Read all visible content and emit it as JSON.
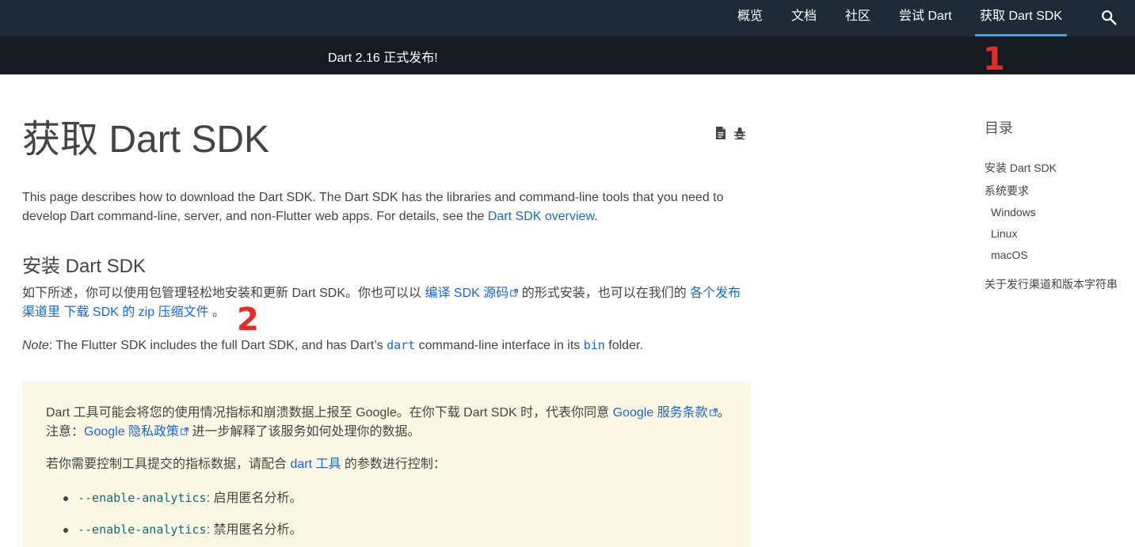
{
  "nav": {
    "items": [
      {
        "label": "概览"
      },
      {
        "label": "文档"
      },
      {
        "label": "社区"
      },
      {
        "label": "尝试 Dart"
      },
      {
        "label": "获取 Dart SDK"
      }
    ],
    "active_index": 4,
    "search_icon": "search-icon"
  },
  "banner": {
    "text": "Dart 2.16 正式发布!"
  },
  "markers": {
    "one": "1",
    "two": "2"
  },
  "page": {
    "title": "获取 Dart SDK",
    "tools": [
      "page-source-icon",
      "bug-report-icon"
    ]
  },
  "intro": {
    "text": "This page describes how to download the Dart SDK. The Dart SDK has the libraries and command-line tools that you need to develop Dart command-line, server, and non-Flutter web apps. For details, see the ",
    "link": "Dart SDK overview",
    "end": "."
  },
  "install": {
    "heading": "安装 Dart SDK",
    "p1_a": "如下所述，你可以使用包管理轻松地安装和更新 Dart SDK。你也可以以 ",
    "p1_link1": "编译 SDK 源码",
    "p1_b": " 的形式安装，也可以在我们的 ",
    "p1_link2": "各个发布渠道里 下载 SDK 的 zip 压缩文件",
    "p1_c": " 。",
    "note_label": "Note",
    "note_a": ": The Flutter SDK includes the full Dart SDK, and has Dart’s ",
    "note_code1": "dart",
    "note_b": " command-line interface in its ",
    "note_code2": "bin",
    "note_c": " folder."
  },
  "notice": {
    "p1_a": "Dart 工具可能会将您的使用情况指标和崩溃数据上报至 Google。在你下载 Dart SDK 时，代表你同意 ",
    "p1_link1": "Google 服务条款",
    "p1_b": "。注意：",
    "p1_link2": "Google 隐私政策",
    "p1_c": " 进一步解释了该服务如何处理你的数据。",
    "p2_a": "若你需要控制工具提交的指标数据，请配合 ",
    "p2_link": "dart 工具",
    "p2_b": " 的参数进行控制：",
    "bullets": [
      {
        "flag": "--enable-analytics",
        "text": ": 启用匿名分析。"
      },
      {
        "flag": "--enable-analytics",
        "text": ": 禁用匿名分析。"
      }
    ]
  },
  "toc": {
    "title": "目录",
    "items": [
      {
        "label": "安装 Dart SDK"
      },
      {
        "label": "系统要求"
      },
      {
        "label": "Windows"
      },
      {
        "label": "Linux"
      },
      {
        "label": "macOS"
      },
      {
        "label": "关于发行渠道和版本字符串"
      }
    ]
  },
  "colors": {
    "nav_bg": "#1e2a38",
    "banner_bg": "#161b22",
    "active_underline": "#2ba6f5",
    "link": "#1967d2",
    "notice_bg": "#fcf8e6",
    "marker": "#e52a2a"
  }
}
